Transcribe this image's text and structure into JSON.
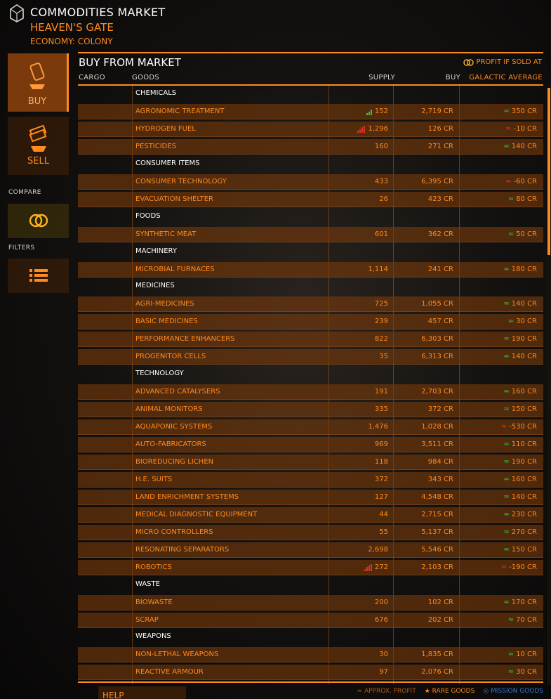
{
  "header": {
    "title": "COMMODITIES MARKET",
    "station": "HEAVEN'S GATE",
    "economy": "ECONOMY: COLONY"
  },
  "nav": {
    "buy_label": "BUY",
    "sell_label": "SELL",
    "compare_heading": "COMPARE",
    "filters_heading": "FILTERS"
  },
  "panel": {
    "title": "BUY FROM MARKET",
    "profit_hint": "PROFIT IF SOLD AT",
    "columns": {
      "cargo": "CARGO",
      "goods": "GOODS",
      "supply": "SUPPLY",
      "buy": "BUY",
      "galactic": "GALACTIC AVERAGE"
    }
  },
  "rows": [
    {
      "type": "category",
      "name": "CHEMICALS"
    },
    {
      "type": "item",
      "name": "AGRONOMIC TREATMENT",
      "supply": "152",
      "supply_icon": "low-supply",
      "buy": "2,719 CR",
      "avg": "350 CR",
      "profit": "positive"
    },
    {
      "type": "item",
      "name": "HYDROGEN FUEL",
      "supply": "1,296",
      "supply_icon": "high-supply",
      "buy": "126 CR",
      "avg": "-10 CR",
      "profit": "negative"
    },
    {
      "type": "item",
      "name": "PESTICIDES",
      "supply": "160",
      "buy": "271 CR",
      "avg": "140 CR",
      "profit": "positive"
    },
    {
      "type": "category",
      "name": "CONSUMER ITEMS"
    },
    {
      "type": "item",
      "name": "CONSUMER TECHNOLOGY",
      "supply": "433",
      "buy": "6,395 CR",
      "avg": "-60 CR",
      "profit": "negative"
    },
    {
      "type": "item",
      "name": "EVACUATION SHELTER",
      "supply": "26",
      "buy": "423 CR",
      "avg": "80 CR",
      "profit": "positive"
    },
    {
      "type": "category",
      "name": "FOODS"
    },
    {
      "type": "item",
      "name": "SYNTHETIC MEAT",
      "supply": "601",
      "buy": "362 CR",
      "avg": "50 CR",
      "profit": "positive"
    },
    {
      "type": "category",
      "name": "MACHINERY"
    },
    {
      "type": "item",
      "name": "MICROBIAL FURNACES",
      "supply": "1,114",
      "buy": "241 CR",
      "avg": "180 CR",
      "profit": "positive"
    },
    {
      "type": "category",
      "name": "MEDICINES"
    },
    {
      "type": "item",
      "name": "AGRI-MEDICINES",
      "supply": "725",
      "buy": "1,055 CR",
      "avg": "140 CR",
      "profit": "positive"
    },
    {
      "type": "item",
      "name": "BASIC MEDICINES",
      "supply": "239",
      "buy": "457 CR",
      "avg": "30 CR",
      "profit": "positive"
    },
    {
      "type": "item",
      "name": "PERFORMANCE ENHANCERS",
      "supply": "822",
      "buy": "6,303 CR",
      "avg": "190 CR",
      "profit": "positive"
    },
    {
      "type": "item",
      "name": "PROGENITOR CELLS",
      "supply": "35",
      "buy": "6,313 CR",
      "avg": "140 CR",
      "profit": "positive"
    },
    {
      "type": "category",
      "name": "TECHNOLOGY"
    },
    {
      "type": "item",
      "name": "ADVANCED CATALYSERS",
      "supply": "191",
      "buy": "2,703 CR",
      "avg": "160 CR",
      "profit": "positive"
    },
    {
      "type": "item",
      "name": "ANIMAL MONITORS",
      "supply": "335",
      "buy": "372 CR",
      "avg": "150 CR",
      "profit": "positive"
    },
    {
      "type": "item",
      "name": "AQUAPONIC SYSTEMS",
      "supply": "1,476",
      "buy": "1,028 CR",
      "avg": "-530 CR",
      "profit": "negative"
    },
    {
      "type": "item",
      "name": "AUTO-FABRICATORS",
      "supply": "969",
      "buy": "3,511 CR",
      "avg": "110 CR",
      "profit": "positive"
    },
    {
      "type": "item",
      "name": "BIOREDUCING LICHEN",
      "supply": "118",
      "buy": "984 CR",
      "avg": "190 CR",
      "profit": "positive"
    },
    {
      "type": "item",
      "name": "H.E. SUITS",
      "supply": "372",
      "buy": "343 CR",
      "avg": "160 CR",
      "profit": "positive"
    },
    {
      "type": "item",
      "name": "LAND ENRICHMENT SYSTEMS",
      "supply": "127",
      "buy": "4,548 CR",
      "avg": "140 CR",
      "profit": "positive"
    },
    {
      "type": "item",
      "name": "MEDICAL DIAGNOSTIC EQUIPMENT",
      "supply": "44",
      "buy": "2,715 CR",
      "avg": "230 CR",
      "profit": "positive"
    },
    {
      "type": "item",
      "name": "MICRO CONTROLLERS",
      "supply": "55",
      "buy": "5,137 CR",
      "avg": "270 CR",
      "profit": "positive"
    },
    {
      "type": "item",
      "name": "RESONATING SEPARATORS",
      "supply": "2,698",
      "buy": "5,546 CR",
      "avg": "150 CR",
      "profit": "positive"
    },
    {
      "type": "item",
      "name": "ROBOTICS",
      "supply": "272",
      "supply_icon": "high-supply",
      "buy": "2,103 CR",
      "avg": "-190 CR",
      "profit": "negative"
    },
    {
      "type": "category",
      "name": "WASTE"
    },
    {
      "type": "item",
      "name": "BIOWASTE",
      "supply": "200",
      "buy": "102 CR",
      "avg": "170 CR",
      "profit": "positive"
    },
    {
      "type": "item",
      "name": "SCRAP",
      "supply": "676",
      "buy": "202 CR",
      "avg": "70 CR",
      "profit": "positive"
    },
    {
      "type": "category",
      "name": "WEAPONS"
    },
    {
      "type": "item",
      "name": "NON-LETHAL WEAPONS",
      "supply": "30",
      "buy": "1,835 CR",
      "avg": "10 CR",
      "profit": "positive"
    },
    {
      "type": "item",
      "name": "REACTIVE ARMOUR",
      "supply": "97",
      "buy": "2,076 CR",
      "avg": "30 CR",
      "profit": "positive"
    }
  ],
  "footer": {
    "help_label": "HELP",
    "approx_label": "APPROX. PROFIT",
    "rare_label": "RARE GOODS",
    "mission_label": "MISSION GOODS"
  },
  "icons": {
    "approx": "≈",
    "star": "★",
    "mission": "◎"
  },
  "colors": {
    "accent": "#ff8a1e",
    "positive": "#3cc33c",
    "negative": "#e0321e",
    "mission": "#2f7ad6",
    "row_bg": "#783a0c"
  },
  "scroll": {
    "position": 0.0,
    "visible_fraction": 0.28
  }
}
